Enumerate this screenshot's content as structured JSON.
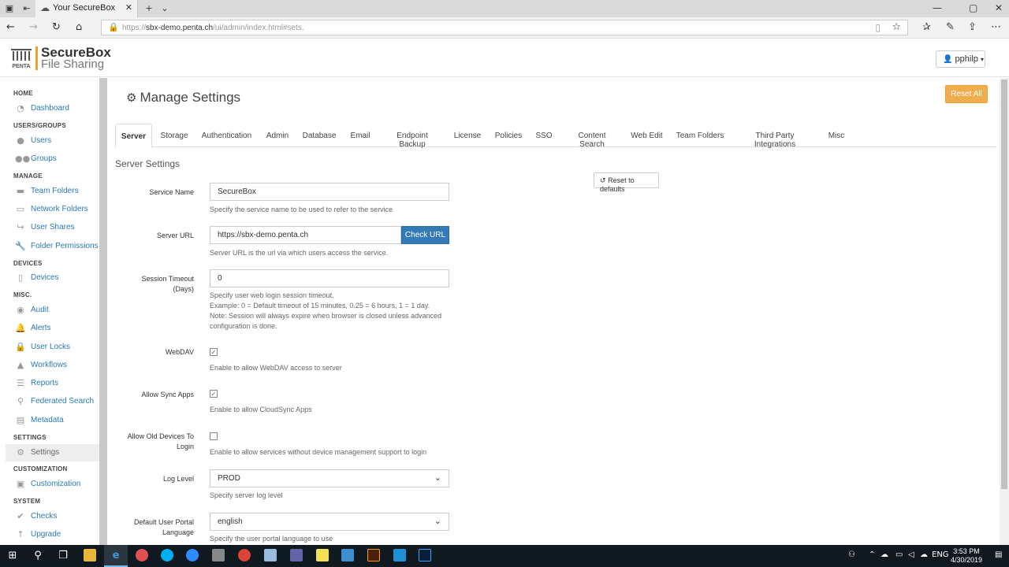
{
  "browser": {
    "tab_title": "Your SecureBox",
    "url_prefix": "https://",
    "url_host": "sbx-demo.penta.ch",
    "url_path": "/ui/admin/index.html#sets."
  },
  "header": {
    "logo_small": "PENTA",
    "logo_line1": "SecureBox",
    "logo_line2": "File Sharing",
    "user_name": "pphilp"
  },
  "sidebar": {
    "sections": [
      {
        "title": "HOME",
        "items": [
          {
            "label": "Dashboard",
            "icon": "dashboard-icon"
          }
        ]
      },
      {
        "title": "USERS/GROUPS",
        "items": [
          {
            "label": "Users",
            "icon": "user-icon"
          },
          {
            "label": "Groups",
            "icon": "users-icon"
          }
        ]
      },
      {
        "title": "MANAGE",
        "items": [
          {
            "label": "Team Folders",
            "icon": "folder-icon"
          },
          {
            "label": "Network Folders",
            "icon": "network-folder-icon"
          },
          {
            "label": "User Shares",
            "icon": "share-icon"
          },
          {
            "label": "Folder Permissions",
            "icon": "wrench-icon"
          }
        ]
      },
      {
        "title": "DEVICES",
        "items": [
          {
            "label": "Devices",
            "icon": "tablet-icon"
          }
        ]
      },
      {
        "title": "MISC.",
        "items": [
          {
            "label": "Audit",
            "icon": "eye-icon"
          },
          {
            "label": "Alerts",
            "icon": "bell-icon"
          },
          {
            "label": "User Locks",
            "icon": "lock-icon"
          },
          {
            "label": "Workflows",
            "icon": "flask-icon"
          },
          {
            "label": "Reports",
            "icon": "list-icon"
          },
          {
            "label": "Federated Search",
            "icon": "search-icon"
          },
          {
            "label": "Metadata",
            "icon": "file-icon"
          }
        ]
      },
      {
        "title": "SETTINGS",
        "items": [
          {
            "label": "Settings",
            "icon": "gear-icon"
          }
        ]
      },
      {
        "title": "CUSTOMIZATION",
        "items": [
          {
            "label": "Customization",
            "icon": "image-icon"
          }
        ]
      },
      {
        "title": "SYSTEM",
        "items": [
          {
            "label": "Checks",
            "icon": "check-icon"
          },
          {
            "label": "Upgrade",
            "icon": "arrow-up-icon"
          }
        ]
      }
    ]
  },
  "main": {
    "title": "Manage Settings",
    "reset_all": "Reset All",
    "tabs": [
      "Server",
      "Storage",
      "Authentication",
      "Admin",
      "Database",
      "Email",
      "Endpoint Backup",
      "License",
      "Policies",
      "SSO",
      "Content Search",
      "Web Edit",
      "Team Folders",
      "Third Party Integrations",
      "Misc"
    ],
    "active_tab": "Server",
    "section_title": "Server Settings",
    "reset_defaults": "Reset to defaults",
    "fields": {
      "service_name": {
        "label": "Service Name",
        "value": "SecureBox",
        "help": "Specify the service name to be used to refer to the service"
      },
      "server_url": {
        "label": "Server URL",
        "value": "https://sbx-demo.penta.ch",
        "button": "Check URL",
        "help": "Server URL is the url via which users access the service."
      },
      "session_timeout": {
        "label_line1": "Session Timeout",
        "label_line2": "(Days)",
        "value": "0",
        "help_lines": [
          "Specify user web login session timeout.",
          "Example: 0 = Default timeout of 15 minutes, 0.25 = 6 hours, 1 = 1 day.",
          "Note: Session will always expire when browser is closed unless advanced",
          "configuration is done."
        ]
      },
      "webdav": {
        "label": "WebDAV",
        "checked": true,
        "help": "Enable to allow WebDAV access to server"
      },
      "sync_apps": {
        "label": "Allow Sync Apps",
        "checked": true,
        "help": "Enable to allow CloudSync Apps"
      },
      "old_devices": {
        "label_line1": "Allow Old Devices To",
        "label_line2": "Login",
        "checked": false,
        "help": "Enable to allow services without device management support to login"
      },
      "log_level": {
        "label": "Log Level",
        "value": "PROD",
        "help": "Specify server log level"
      },
      "portal_language": {
        "label_line1": "Default User Portal",
        "label_line2": "Language",
        "value": "english",
        "help": "Specify the user portal language to use"
      }
    }
  },
  "taskbar": {
    "lang": "ENG",
    "time": "3:53 PM",
    "date": "4/30/2019"
  }
}
